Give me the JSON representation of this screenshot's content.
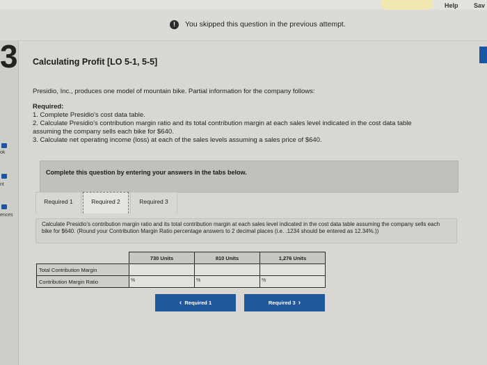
{
  "top_bar": {
    "help": "Help",
    "save": "Sav"
  },
  "notice": {
    "icon": "!",
    "text": "You skipped this question in the previous attempt."
  },
  "question_number": "3",
  "left_rail": [
    "ok",
    "nt",
    "ences"
  ],
  "question": {
    "title": "Calculating Profit [LO 5-1, 5-5]",
    "intro": "Presidio, Inc., produces one model of mountain bike. Partial information for the company follows:",
    "required_heading": "Required:",
    "required_lines": [
      "1. Complete Presidio's cost data table.",
      "2. Calculate Presidio's contribution margin ratio and its total contribution margin at each sales level indicated in the cost data table",
      "assuming the company sells each bike for $640.",
      "3. Calculate net operating income (loss) at each of the sales levels assuming a sales price of $640."
    ]
  },
  "instructions": "Complete this question by entering your answers in the tabs below.",
  "tabs": [
    {
      "label": "Required 1",
      "active": false
    },
    {
      "label": "Required 2",
      "active": true
    },
    {
      "label": "Required 3",
      "active": false
    }
  ],
  "tab_content": "Calculate Presidio's contribution margin ratio and its total contribution margin at each sales level indicated in the cost data table assuming the company sells each bike for $640. (Round your Contribution Margin Ratio percentage answers to 2 decimal places (i.e. .1234 should be entered as 12.34%.))",
  "table": {
    "columns": [
      "730 Units",
      "810 Units",
      "1,276 Units"
    ],
    "rows": [
      {
        "label": "Total Contribution Margin",
        "unit": ""
      },
      {
        "label": "Contribution Margin Ratio",
        "unit": "%"
      }
    ]
  },
  "nav": {
    "prev": "Required 1",
    "next": "Required 3",
    "prev_icon": "‹",
    "next_icon": "›"
  },
  "colors": {
    "nav_button": "#21579b",
    "marker": "#1b56a6"
  }
}
